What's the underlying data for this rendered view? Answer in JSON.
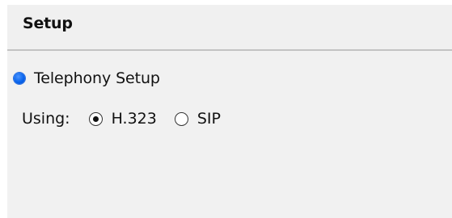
{
  "header": {
    "title": "Setup"
  },
  "telephony": {
    "label": "Telephony Setup",
    "status_color": "#0a64ec",
    "icon": "status-dot-icon"
  },
  "protocol": {
    "label": "Using:",
    "options": [
      {
        "label": "H.323",
        "selected": true
      },
      {
        "label": "SIP",
        "selected": false
      }
    ]
  }
}
